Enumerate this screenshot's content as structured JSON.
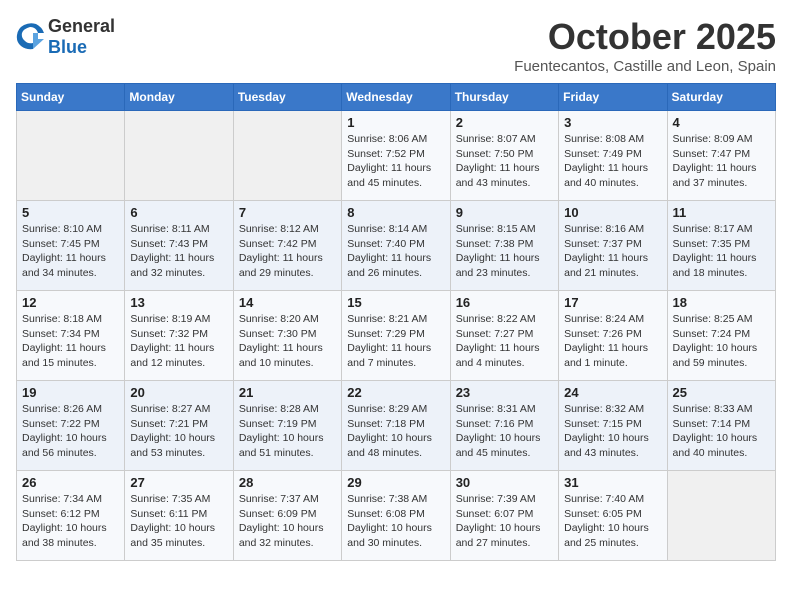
{
  "logo": {
    "general": "General",
    "blue": "Blue"
  },
  "header": {
    "month": "October 2025",
    "location": "Fuentecantos, Castille and Leon, Spain"
  },
  "weekdays": [
    "Sunday",
    "Monday",
    "Tuesday",
    "Wednesday",
    "Thursday",
    "Friday",
    "Saturday"
  ],
  "weeks": [
    [
      {
        "day": "",
        "info": ""
      },
      {
        "day": "",
        "info": ""
      },
      {
        "day": "",
        "info": ""
      },
      {
        "day": "1",
        "info": "Sunrise: 8:06 AM\nSunset: 7:52 PM\nDaylight: 11 hours\nand 45 minutes."
      },
      {
        "day": "2",
        "info": "Sunrise: 8:07 AM\nSunset: 7:50 PM\nDaylight: 11 hours\nand 43 minutes."
      },
      {
        "day": "3",
        "info": "Sunrise: 8:08 AM\nSunset: 7:49 PM\nDaylight: 11 hours\nand 40 minutes."
      },
      {
        "day": "4",
        "info": "Sunrise: 8:09 AM\nSunset: 7:47 PM\nDaylight: 11 hours\nand 37 minutes."
      }
    ],
    [
      {
        "day": "5",
        "info": "Sunrise: 8:10 AM\nSunset: 7:45 PM\nDaylight: 11 hours\nand 34 minutes."
      },
      {
        "day": "6",
        "info": "Sunrise: 8:11 AM\nSunset: 7:43 PM\nDaylight: 11 hours\nand 32 minutes."
      },
      {
        "day": "7",
        "info": "Sunrise: 8:12 AM\nSunset: 7:42 PM\nDaylight: 11 hours\nand 29 minutes."
      },
      {
        "day": "8",
        "info": "Sunrise: 8:14 AM\nSunset: 7:40 PM\nDaylight: 11 hours\nand 26 minutes."
      },
      {
        "day": "9",
        "info": "Sunrise: 8:15 AM\nSunset: 7:38 PM\nDaylight: 11 hours\nand 23 minutes."
      },
      {
        "day": "10",
        "info": "Sunrise: 8:16 AM\nSunset: 7:37 PM\nDaylight: 11 hours\nand 21 minutes."
      },
      {
        "day": "11",
        "info": "Sunrise: 8:17 AM\nSunset: 7:35 PM\nDaylight: 11 hours\nand 18 minutes."
      }
    ],
    [
      {
        "day": "12",
        "info": "Sunrise: 8:18 AM\nSunset: 7:34 PM\nDaylight: 11 hours\nand 15 minutes."
      },
      {
        "day": "13",
        "info": "Sunrise: 8:19 AM\nSunset: 7:32 PM\nDaylight: 11 hours\nand 12 minutes."
      },
      {
        "day": "14",
        "info": "Sunrise: 8:20 AM\nSunset: 7:30 PM\nDaylight: 11 hours\nand 10 minutes."
      },
      {
        "day": "15",
        "info": "Sunrise: 8:21 AM\nSunset: 7:29 PM\nDaylight: 11 hours\nand 7 minutes."
      },
      {
        "day": "16",
        "info": "Sunrise: 8:22 AM\nSunset: 7:27 PM\nDaylight: 11 hours\nand 4 minutes."
      },
      {
        "day": "17",
        "info": "Sunrise: 8:24 AM\nSunset: 7:26 PM\nDaylight: 11 hours\nand 1 minute."
      },
      {
        "day": "18",
        "info": "Sunrise: 8:25 AM\nSunset: 7:24 PM\nDaylight: 10 hours\nand 59 minutes."
      }
    ],
    [
      {
        "day": "19",
        "info": "Sunrise: 8:26 AM\nSunset: 7:22 PM\nDaylight: 10 hours\nand 56 minutes."
      },
      {
        "day": "20",
        "info": "Sunrise: 8:27 AM\nSunset: 7:21 PM\nDaylight: 10 hours\nand 53 minutes."
      },
      {
        "day": "21",
        "info": "Sunrise: 8:28 AM\nSunset: 7:19 PM\nDaylight: 10 hours\nand 51 minutes."
      },
      {
        "day": "22",
        "info": "Sunrise: 8:29 AM\nSunset: 7:18 PM\nDaylight: 10 hours\nand 48 minutes."
      },
      {
        "day": "23",
        "info": "Sunrise: 8:31 AM\nSunset: 7:16 PM\nDaylight: 10 hours\nand 45 minutes."
      },
      {
        "day": "24",
        "info": "Sunrise: 8:32 AM\nSunset: 7:15 PM\nDaylight: 10 hours\nand 43 minutes."
      },
      {
        "day": "25",
        "info": "Sunrise: 8:33 AM\nSunset: 7:14 PM\nDaylight: 10 hours\nand 40 minutes."
      }
    ],
    [
      {
        "day": "26",
        "info": "Sunrise: 7:34 AM\nSunset: 6:12 PM\nDaylight: 10 hours\nand 38 minutes."
      },
      {
        "day": "27",
        "info": "Sunrise: 7:35 AM\nSunset: 6:11 PM\nDaylight: 10 hours\nand 35 minutes."
      },
      {
        "day": "28",
        "info": "Sunrise: 7:37 AM\nSunset: 6:09 PM\nDaylight: 10 hours\nand 32 minutes."
      },
      {
        "day": "29",
        "info": "Sunrise: 7:38 AM\nSunset: 6:08 PM\nDaylight: 10 hours\nand 30 minutes."
      },
      {
        "day": "30",
        "info": "Sunrise: 7:39 AM\nSunset: 6:07 PM\nDaylight: 10 hours\nand 27 minutes."
      },
      {
        "day": "31",
        "info": "Sunrise: 7:40 AM\nSunset: 6:05 PM\nDaylight: 10 hours\nand 25 minutes."
      },
      {
        "day": "",
        "info": ""
      }
    ]
  ]
}
